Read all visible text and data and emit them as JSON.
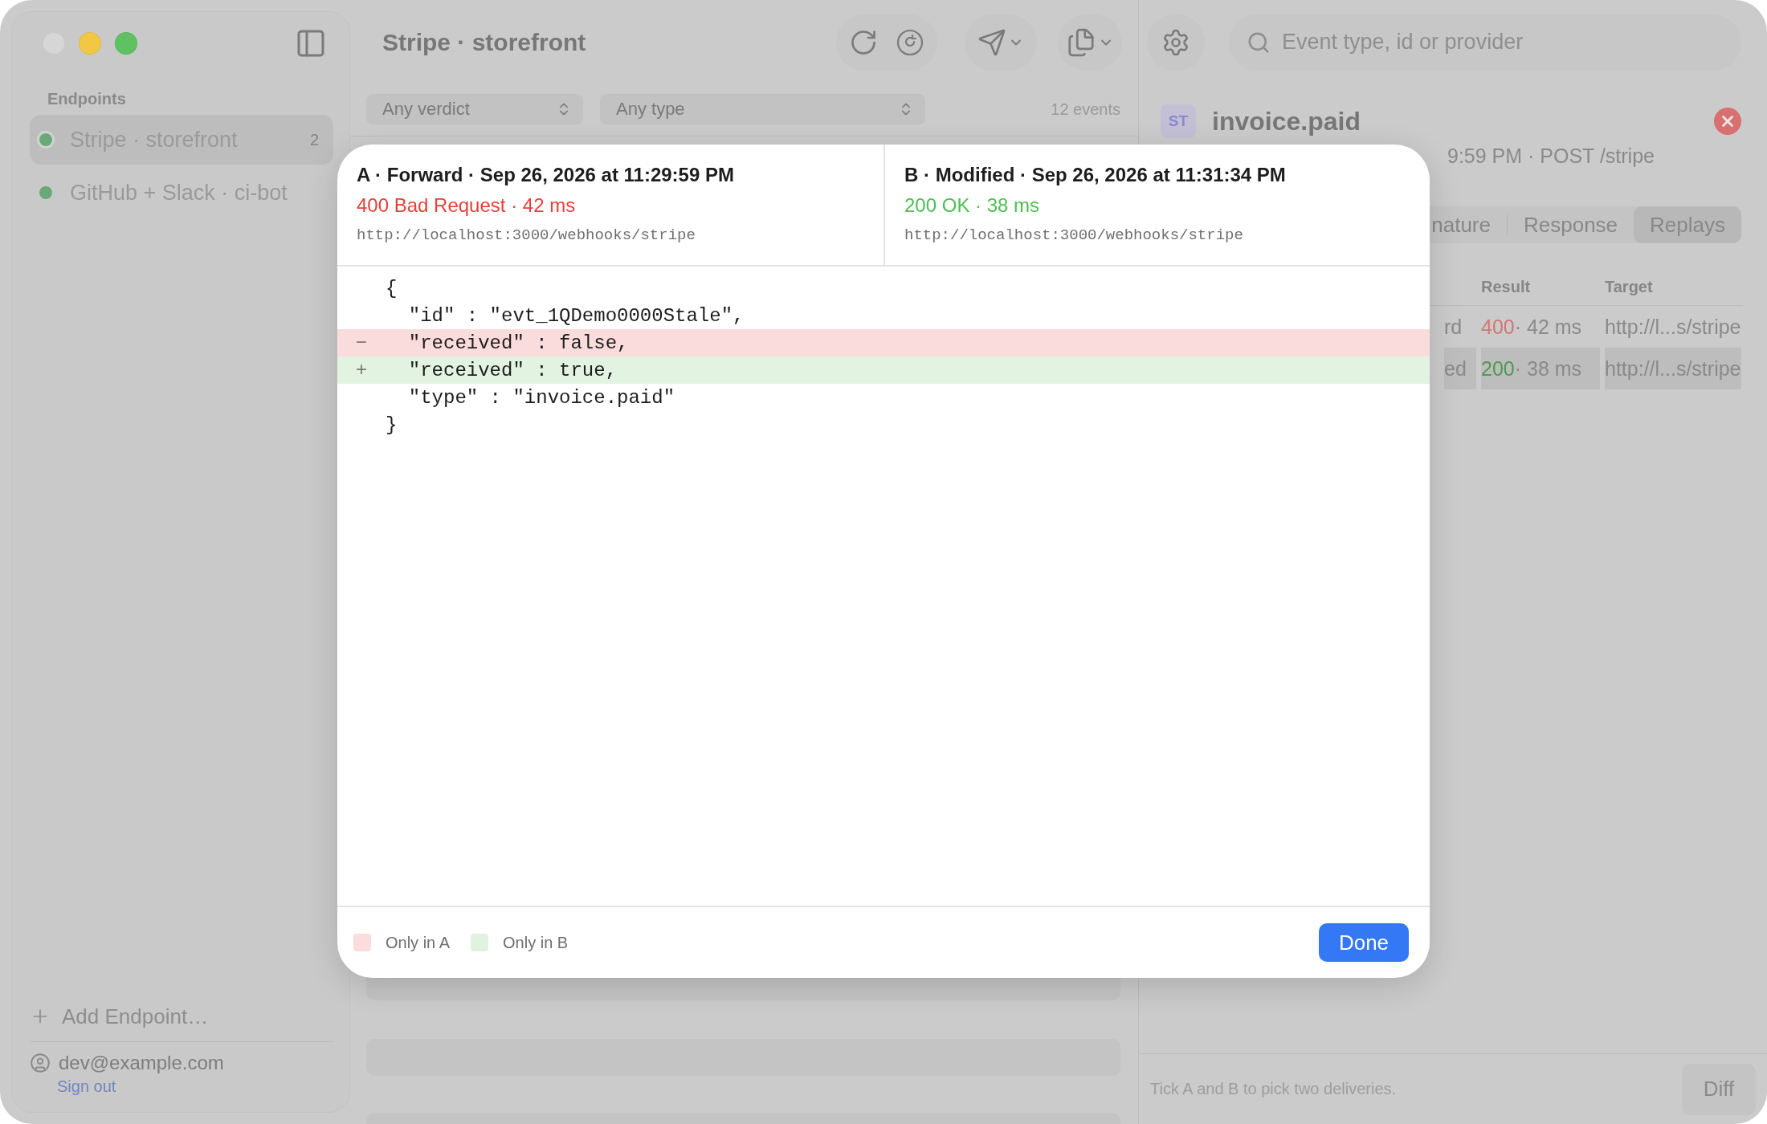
{
  "sidebar": {
    "section_title": "Endpoints",
    "items": [
      {
        "name": "Stripe · storefront",
        "count": "2",
        "selected": true,
        "color": "#6aa878"
      },
      {
        "name": "GitHub + Slack · ci-bot",
        "selected": false,
        "color": "#6aa878"
      }
    ],
    "add_button": "Add Endpoint…",
    "account": {
      "email": "dev@example.com",
      "sign_out": "Sign out"
    }
  },
  "list": {
    "title": "Stripe · storefront",
    "filters": [
      {
        "label": "Any verdict"
      },
      {
        "label": "Any type"
      }
    ],
    "count": "12 events"
  },
  "detail": {
    "search": {
      "placeholder": "Event type, id or provider"
    },
    "badge": "ST",
    "title": "invoice.paid",
    "subtitle": "9:59 PM · POST /stripe",
    "tabs": [
      {
        "label": "nature",
        "selected": false
      },
      {
        "label": "Response",
        "selected": false
      },
      {
        "label": "Replays",
        "selected": true
      }
    ],
    "columns": [
      "Result",
      "Target"
    ],
    "rows": [
      {
        "column_1": "rd",
        "code": "400",
        "kind": "error",
        "time": " · 42 ms",
        "target": "http://l...s/stripe",
        "selected": false
      },
      {
        "column_1": "ed",
        "code": "200",
        "kind": "ok",
        "time": " · 38 ms",
        "target": "http://l...s/stripe",
        "selected": true
      }
    ],
    "hint": "Tick A and B to pick two deliveries.",
    "diff_button": {
      "label": "Diff",
      "disabled": true
    }
  },
  "diff_modal": {
    "sides": [
      {
        "title": "A · Forward · Sep 26, 2026 at 11:29:59 PM",
        "status": "400 Bad Request · 42 ms",
        "kind": "error",
        "url": "http://localhost:3000/webhooks/stripe"
      },
      {
        "title": "B · Modified · Sep 26, 2026 at 11:31:34 PM",
        "status": "200 OK · 38 ms",
        "kind": "ok",
        "url": "http://localhost:3000/webhooks/stripe"
      }
    ],
    "lines": [
      {
        "kind": "same",
        "text": "{"
      },
      {
        "kind": "same",
        "text": "  \"id\" : \"evt_1QDemo0000Stale\","
      },
      {
        "kind": "removed",
        "sign": "−",
        "text": "  \"received\" : false,"
      },
      {
        "kind": "added",
        "sign": "+",
        "text": "  \"received\" : true,"
      },
      {
        "kind": "same",
        "text": "  \"type\" : \"invoice.paid\""
      },
      {
        "kind": "same",
        "text": "}"
      }
    ],
    "legend": [
      {
        "kind": "removed",
        "label": "Only in A"
      },
      {
        "kind": "added",
        "label": "Only in B"
      }
    ],
    "done_button": "Done"
  }
}
